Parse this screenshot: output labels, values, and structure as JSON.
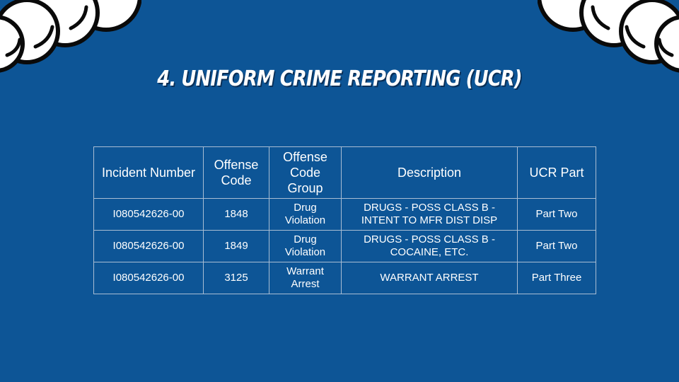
{
  "slide": {
    "title": "4. Uniform Crime Reporting (UCR)"
  },
  "table": {
    "headers": [
      "Incident Number",
      "Offense Code",
      "Offense Code Group",
      "Description",
      "UCR Part"
    ],
    "rows": [
      [
        "I080542626-00",
        "1848",
        "Drug Violation",
        "DRUGS - POSS CLASS B - INTENT TO MFR DIST DISP",
        "Part Two"
      ],
      [
        "I080542626-00",
        "1849",
        "Drug Violation",
        "DRUGS - POSS CLASS B - COCAINE, ETC.",
        "Part Two"
      ],
      [
        "I080542626-00",
        "3125",
        "Warrant Arrest",
        "WARRANT ARREST",
        "Part Three"
      ]
    ]
  },
  "colors": {
    "background": "#0d5596",
    "grid": "#a9bdd3",
    "cloud": "#ffffff"
  }
}
